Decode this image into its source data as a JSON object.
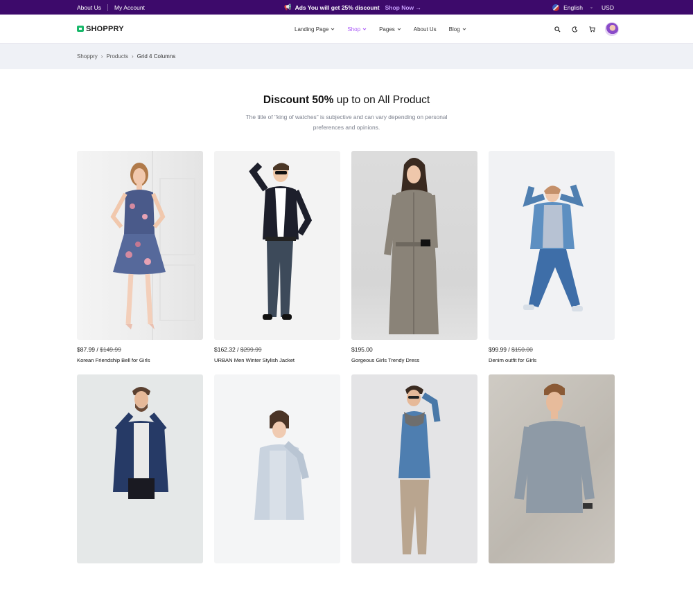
{
  "topbar": {
    "links": [
      "About Us",
      "My Account"
    ],
    "promo_icon": "megaphone-icon",
    "promo_text": "Ads You will get 25% discount",
    "promo_link": "Shop Now →",
    "language": "English",
    "currency": "USD"
  },
  "header": {
    "logo": "SHOPPRY",
    "nav": [
      {
        "label": "Landing Page",
        "dropdown": true
      },
      {
        "label": "Shop",
        "dropdown": true,
        "active": true
      },
      {
        "label": "Pages",
        "dropdown": true
      },
      {
        "label": "About Us",
        "dropdown": false
      },
      {
        "label": "Blog",
        "dropdown": true
      }
    ],
    "icons": [
      "search-icon",
      "moon-icon",
      "cart-icon",
      "avatar"
    ]
  },
  "breadcrumb": [
    "Shoppry",
    "Products",
    "Grid 4 Columns"
  ],
  "section": {
    "title_bold": "Discount 50%",
    "title_rest": " up to on All Product",
    "subtitle": "The title of \"king of watches\" is subjective and can vary depending on personal preferences and opinions."
  },
  "products": [
    {
      "price": "$87.99",
      "old_price": "$149.99",
      "name": "Korean Friendship Bell for Girls"
    },
    {
      "price": "$162.32",
      "old_price": "$299.99",
      "name": "URBAN Men Winter Stylish Jacket"
    },
    {
      "price": "$195.00",
      "old_price": "",
      "name": "Gorgeous Girls Trendy Dress"
    },
    {
      "price": "$99.99",
      "old_price": "$150.00",
      "name": "Denim outfit for Girls"
    },
    {
      "price": "",
      "old_price": "",
      "name": ""
    },
    {
      "price": "",
      "old_price": "",
      "name": ""
    },
    {
      "price": "",
      "old_price": "",
      "name": ""
    },
    {
      "price": "",
      "old_price": "",
      "name": ""
    }
  ],
  "colors": {
    "topbar_bg": "#3d0a6b",
    "accent": "#a855f7",
    "logo_green": "#18b86a",
    "breadcrumb_bg": "#eff1f6"
  }
}
